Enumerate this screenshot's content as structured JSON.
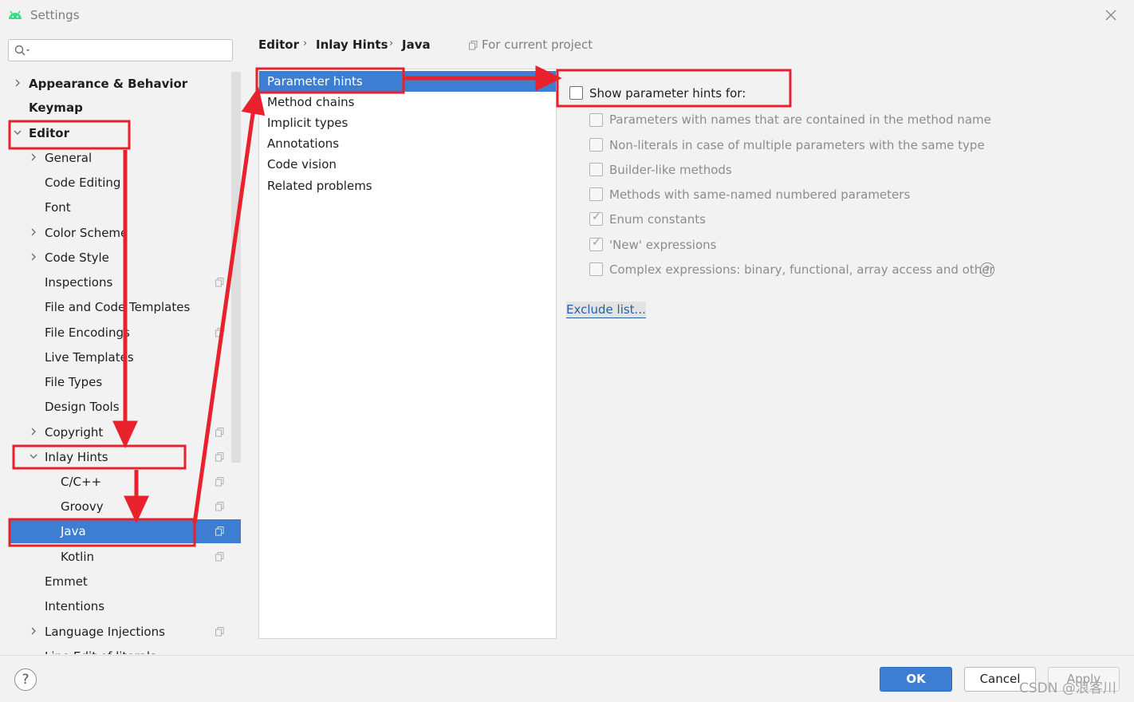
{
  "window": {
    "title": "Settings"
  },
  "search": {
    "placeholder": ""
  },
  "tree": {
    "items": [
      {
        "label": "Appearance & Behavior",
        "expandable": true,
        "expanded": false
      },
      {
        "label": "Keymap"
      },
      {
        "label": "Editor",
        "expandable": true,
        "expanded": true
      },
      {
        "label": "General",
        "expandable": true
      },
      {
        "label": "Code Editing"
      },
      {
        "label": "Font"
      },
      {
        "label": "Color Scheme",
        "expandable": true
      },
      {
        "label": "Code Style",
        "expandable": true
      },
      {
        "label": "Inspections"
      },
      {
        "label": "File and Code Templates"
      },
      {
        "label": "File Encodings"
      },
      {
        "label": "Live Templates"
      },
      {
        "label": "File Types"
      },
      {
        "label": "Design Tools"
      },
      {
        "label": "Copyright",
        "expandable": true
      },
      {
        "label": "Inlay Hints",
        "expandable": true,
        "expanded": true
      },
      {
        "label": "C/C++"
      },
      {
        "label": "Groovy"
      },
      {
        "label": "Java",
        "selected": true
      },
      {
        "label": "Kotlin"
      },
      {
        "label": "Emmet"
      },
      {
        "label": "Intentions"
      },
      {
        "label": "Language Injections",
        "expandable": true
      },
      {
        "label": "Line Edit of literals"
      }
    ]
  },
  "breadcrumb": {
    "items": [
      "Editor",
      "Inlay Hints",
      "Java"
    ],
    "scope": "For current project"
  },
  "hint_types": {
    "items": [
      "Parameter hints",
      "Method chains",
      "Implicit types",
      "Annotations",
      "Code vision",
      "Related problems"
    ],
    "selected": "Parameter hints"
  },
  "options": {
    "main_label": "Show parameter hints for:",
    "main_checked": false,
    "items": [
      {
        "label": "Parameters with names that are contained in the method name",
        "checked": false
      },
      {
        "label": "Non-literals in case of multiple parameters with the same type",
        "checked": false
      },
      {
        "label": "Builder-like methods",
        "checked": false
      },
      {
        "label": "Methods with same-named numbered parameters",
        "checked": false
      },
      {
        "label": "Enum constants",
        "checked": true
      },
      {
        "label": "'New' expressions",
        "checked": true
      },
      {
        "label": "Complex expressions: binary, functional, array access and other",
        "checked": false
      }
    ],
    "exclude_link": "Exclude list..."
  },
  "buttons": {
    "help": "?",
    "ok": "OK",
    "cancel": "Cancel",
    "apply": "Apply"
  },
  "watermark": "CSDN @浪客川",
  "colors": {
    "accent": "#3d7ed2",
    "annotation": "#e8212c"
  }
}
